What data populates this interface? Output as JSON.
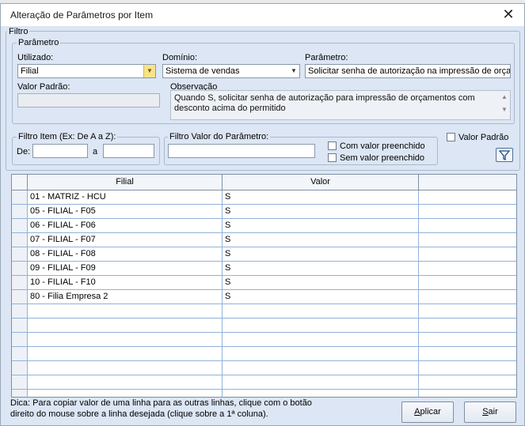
{
  "window": {
    "title": "Alteração de Parâmetros por Item"
  },
  "filtro": {
    "label": "Filtro",
    "parametro_group": {
      "label": "Parâmetro",
      "utilizado": {
        "label": "Utilizado:",
        "value": "Filial"
      },
      "dominio": {
        "label": "Domínio:",
        "value": "Sistema de vendas"
      },
      "parametro": {
        "label": "Parâmetro:",
        "value": "Solicitar senha de autorização na impressão de orçamentos"
      },
      "valor_padrao": {
        "label": "Valor Padrão:",
        "value": ""
      },
      "observacao": {
        "label": "Observação",
        "value": "Quando S, solicitar senha de autorização para impressão de orçamentos com desconto acima do permitido"
      }
    },
    "filtro_item": {
      "label": "Filtro Item (Ex: De A a Z):",
      "de_label": "De:",
      "a_label": "a",
      "de_value": "",
      "a_value": ""
    },
    "filtro_valor": {
      "label": "Filtro Valor do Parâmetro:",
      "value": "",
      "com_valor": "Com valor preenchido",
      "sem_valor": "Sem valor preenchido"
    },
    "valor_padrao_check": "Valor Padrão"
  },
  "grid": {
    "columns": [
      "Filial",
      "Valor"
    ],
    "rows": [
      {
        "filial": "01 - MATRIZ - HCU",
        "valor": "S"
      },
      {
        "filial": "05 - FILIAL - F05",
        "valor": "S"
      },
      {
        "filial": "06 - FILIAL - F06",
        "valor": "S"
      },
      {
        "filial": "07 - FILIAL - F07",
        "valor": "S"
      },
      {
        "filial": "08 - FILIAL - F08",
        "valor": "S"
      },
      {
        "filial": "09 - FILIAL - F09",
        "valor": "S"
      },
      {
        "filial": "10 - FILIAL - F10",
        "valor": "S"
      },
      {
        "filial": "80 - Filia Empresa 2",
        "valor": "S"
      }
    ],
    "empty_rows": 7
  },
  "footer": {
    "hint_line1": "Dica: Para copiar valor de uma linha para as outras linhas, clique com o botão",
    "hint_line2": "direito do mouse sobre a linha desejada (clique sobre a 1ª coluna).",
    "aplicar_accel": "A",
    "aplicar_rest": "plicar",
    "sair_accel": "S",
    "sair_rest": "air"
  },
  "icons": {
    "close": "close-icon",
    "filter": "filter-icon",
    "dropdown": "chevron-down-icon"
  },
  "colors": {
    "client_bg": "#dce6f4",
    "grid_line": "#8fb3d9",
    "combo_button": "#f7e38c"
  }
}
